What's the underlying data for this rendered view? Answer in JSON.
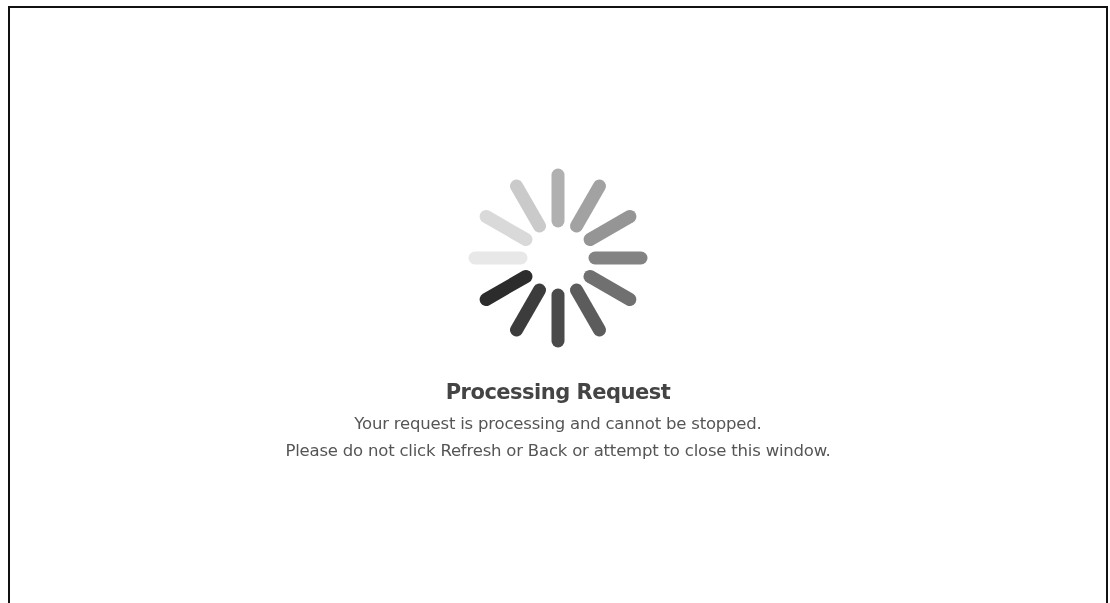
{
  "dialog": {
    "title": "Processing Request",
    "message_lines": [
      "Your request is processing and cannot be stopped.",
      "Please do not click Refresh or Back or attempt to close this window."
    ]
  }
}
